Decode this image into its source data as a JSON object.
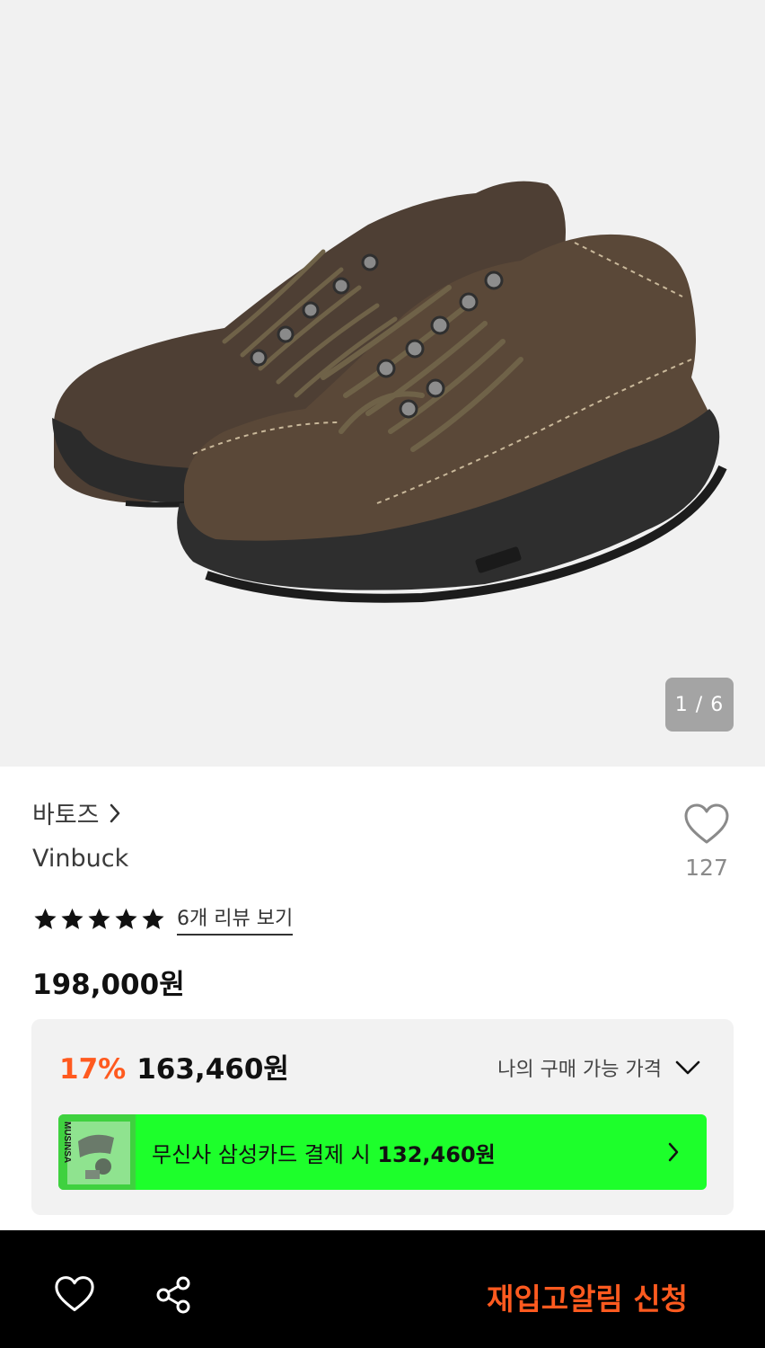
{
  "gallery": {
    "counter": "1 / 6",
    "image_alt": "brown nubuck trail sneakers"
  },
  "product": {
    "brand": "바토즈",
    "name": "Vinbuck",
    "like_count": "127",
    "rating_stars": 5,
    "review_link": "6개 리뷰 보기",
    "original_price": "198,000원"
  },
  "price_card": {
    "discount_rate": "17%",
    "discount_price": "163,460원",
    "my_price_label": "나의 구매 가능 가격",
    "card_offer_prefix": "무신사 삼성카드 결제 시 ",
    "card_offer_price": "132,460원",
    "card_thumb_text": "MUSINSA",
    "banner_color": "#1dff2b"
  },
  "bottom_bar": {
    "restock_label": "재입고알림 신청",
    "accent_color": "#ff5a1f"
  },
  "icons": [
    "chevron-right-icon",
    "heart-outline-icon",
    "star-icon",
    "chevron-down-icon",
    "share-icon"
  ]
}
